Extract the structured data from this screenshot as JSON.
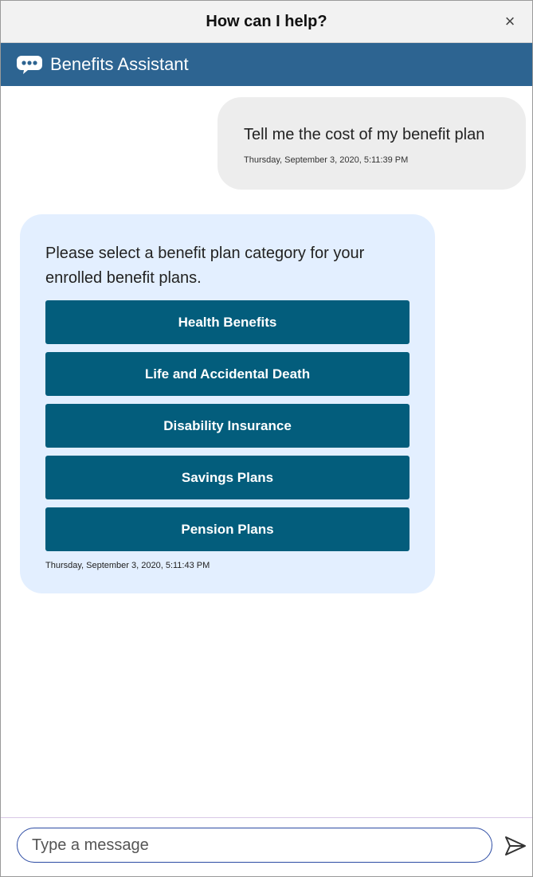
{
  "window": {
    "title": "How can I help?",
    "close_glyph": "×"
  },
  "header": {
    "name": "Benefits Assistant",
    "icon": "chat-bubble-icon",
    "color": "#2d6491"
  },
  "conversation": {
    "user_message": {
      "text": "Tell me the cost of my benefit plan",
      "timestamp": "Thursday, September 3, 2020, 5:11:39 PM"
    },
    "bot_message": {
      "text": "Please select a benefit plan category for your enrolled benefit plans.",
      "options": [
        "Health Benefits",
        "Life and Accidental Death",
        "Disability Insurance",
        "Savings Plans",
        "Pension Plans"
      ],
      "option_color": "#035d7c",
      "timestamp": "Thursday, September 3, 2020, 5:11:43 PM"
    }
  },
  "composer": {
    "placeholder": "Type a message",
    "value": "",
    "send_icon": "send-icon"
  }
}
